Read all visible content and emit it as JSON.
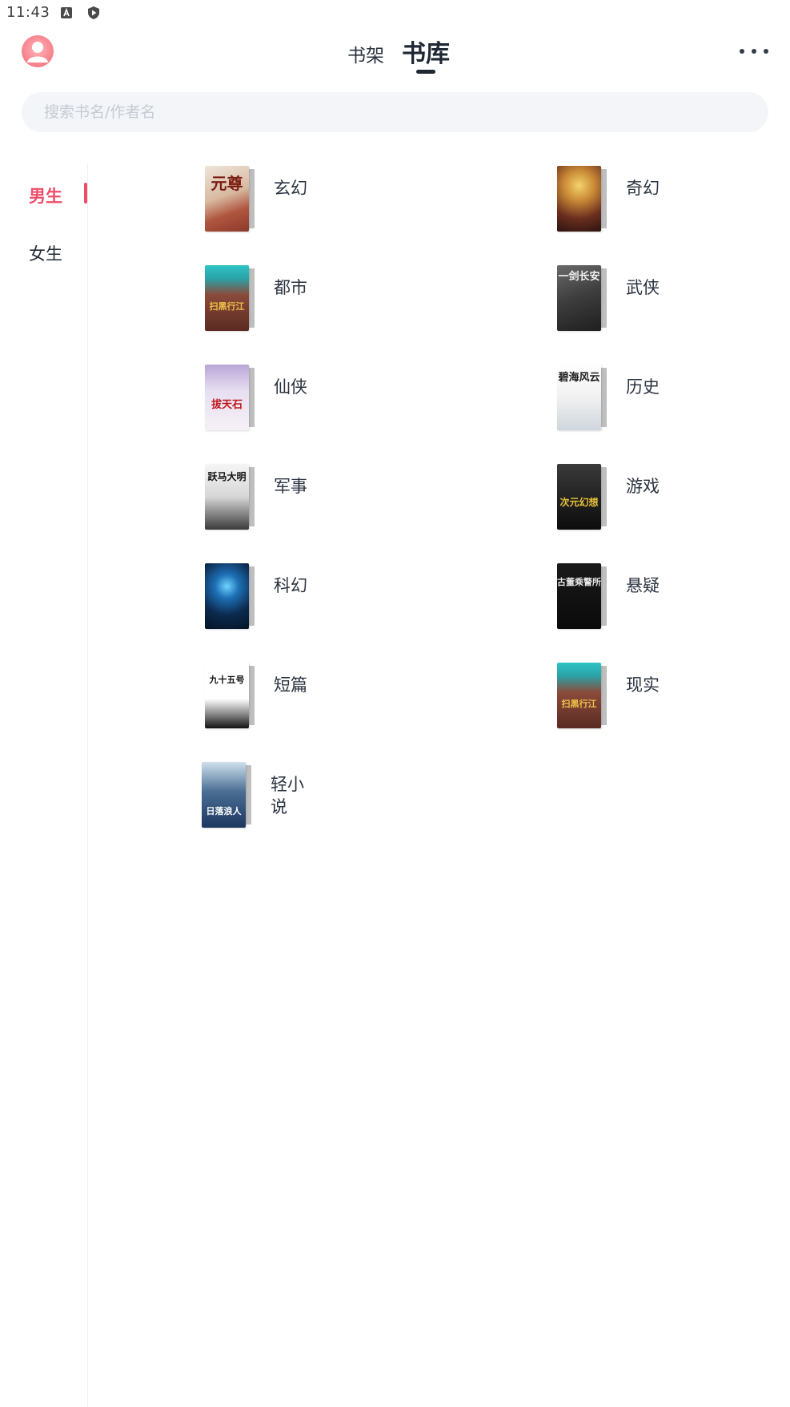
{
  "status_bar": {
    "time": "11:43",
    "icons": [
      "keyboard-a-icon",
      "play-shield-icon"
    ]
  },
  "header": {
    "tabs": [
      {
        "label": "书架",
        "active": false
      },
      {
        "label": "书库",
        "active": true
      }
    ],
    "avatar_icon": "user-avatar-icon",
    "more_icon": "more-dots-icon"
  },
  "search": {
    "placeholder": "搜索书名/作者名",
    "value": ""
  },
  "sidebar": {
    "items": [
      {
        "label": "男生",
        "active": true
      },
      {
        "label": "女生",
        "active": false
      }
    ],
    "accent_color": "#ee4d6a"
  },
  "categories": [
    {
      "label": "玄幻",
      "cover_art": "元尊"
    },
    {
      "label": "奇幻",
      "cover_art": ""
    },
    {
      "label": "都市",
      "cover_art": "扫黑行江"
    },
    {
      "label": "武侠",
      "cover_art": "一剑长安"
    },
    {
      "label": "仙侠",
      "cover_art": "拔天石"
    },
    {
      "label": "历史",
      "cover_art": "碧海风云"
    },
    {
      "label": "军事",
      "cover_art": "跃马大明"
    },
    {
      "label": "游戏",
      "cover_art": "次元幻想"
    },
    {
      "label": "科幻",
      "cover_art": ""
    },
    {
      "label": "悬疑",
      "cover_art": "古董乘警所"
    },
    {
      "label": "短篇",
      "cover_art": "九十五号"
    },
    {
      "label": "现实",
      "cover_art": "扫黑行江"
    },
    {
      "label": "轻小说",
      "cover_art": "日落浪人"
    }
  ]
}
